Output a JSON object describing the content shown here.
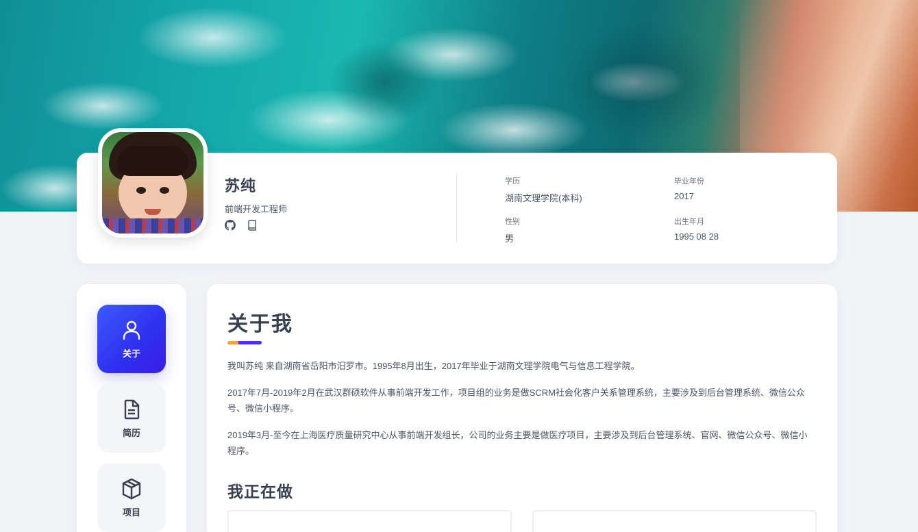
{
  "profile": {
    "name": "苏纯",
    "title": "前端开发工程师",
    "social": [
      {
        "icon": "github-icon"
      },
      {
        "icon": "book-icon"
      }
    ],
    "info": {
      "education_label": "学历",
      "education_value": "湖南文理学院(本科)",
      "graduation_label": "毕业年份",
      "graduation_value": "2017",
      "gender_label": "性别",
      "gender_value": "男",
      "birth_label": "出生年月",
      "birth_value": "1995 08 28"
    }
  },
  "nav": {
    "items": [
      {
        "label": "关于",
        "icon": "user-icon",
        "active": true
      },
      {
        "label": "简历",
        "icon": "document-icon",
        "active": false
      },
      {
        "label": "项目",
        "icon": "box-icon",
        "active": false
      }
    ]
  },
  "main": {
    "title": "关于我",
    "paragraphs": [
      "我叫苏纯 来自湖南省岳阳市汨罗市。1995年8月出生，2017年毕业于湖南文理学院电气与信息工程学院。",
      "2017年7月-2019年2月在武汉群硕软件从事前端开发工作，项目组的业务是做SCRM社会化客户关系管理系统，主要涉及到后台管理系统、微信公众号、微信小程序。",
      "2019年3月-至今在上海医疗质量研究中心从事前端开发组长，公司的业务主要是做医疗项目，主要涉及到后台管理系统、官网、微信公众号、微信小程序。"
    ],
    "doing_title": "我正在做"
  },
  "colors": {
    "accent": "#2f2ff0",
    "accent_orange": "#f59e42",
    "background": "#f3f4f8"
  }
}
